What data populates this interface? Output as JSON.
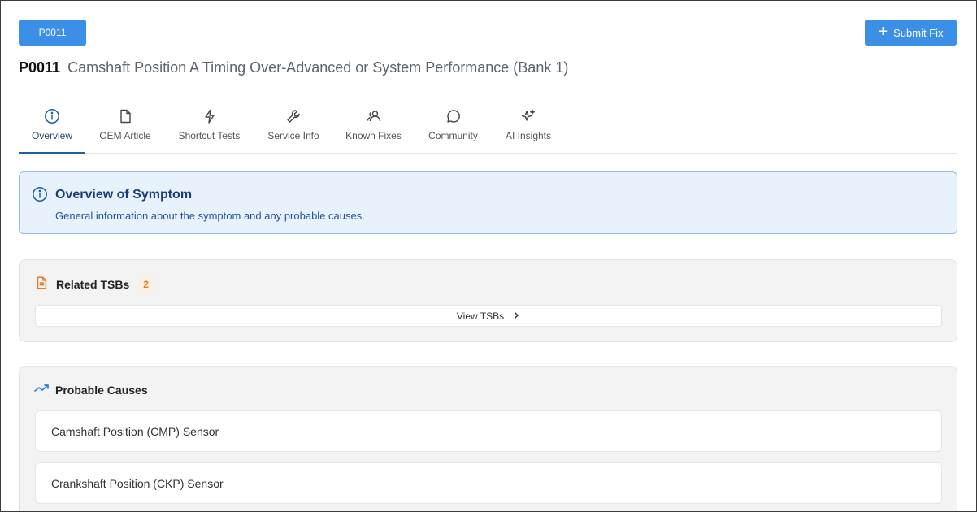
{
  "header": {
    "code_chip": "P0011",
    "submit_label": "Submit Fix",
    "title_code": "P0011",
    "title_desc": "Camshaft Position A Timing Over-Advanced or System Performance (Bank 1)"
  },
  "tabs": [
    {
      "label": "Overview",
      "icon": "info-circle-icon",
      "active": true
    },
    {
      "label": "OEM Article",
      "icon": "document-icon",
      "active": false
    },
    {
      "label": "Shortcut Tests",
      "icon": "lightning-icon",
      "active": false
    },
    {
      "label": "Service Info",
      "icon": "wrench-icon",
      "active": false
    },
    {
      "label": "Known Fixes",
      "icon": "users-icon",
      "active": false
    },
    {
      "label": "Community",
      "icon": "chat-bubble-icon",
      "active": false
    },
    {
      "label": "AI Insights",
      "icon": "sparkle-icon",
      "active": false
    }
  ],
  "overview": {
    "heading": "Overview of Symptom",
    "subtext": "General information about the symptom and any probable causes."
  },
  "tsbs": {
    "title": "Related TSBs",
    "count": "2",
    "view_label": "View TSBs"
  },
  "causes": {
    "title": "Probable Causes",
    "items": [
      "Camshaft Position (CMP) Sensor",
      "Crankshaft Position (CKP) Sensor"
    ]
  },
  "colors": {
    "accent": "#3b8fe6",
    "info_bg": "#e8f2fc",
    "badge_orange": "#e07a1f"
  }
}
